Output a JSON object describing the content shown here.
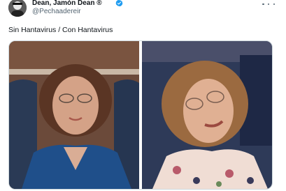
{
  "post": {
    "author_name": "Dean, Jamón Dean ®",
    "handle": "@Pechaadereir",
    "verified": true,
    "text": "Sin Hantavirus / Con Hantavirus"
  },
  "media": {
    "panels": [
      {
        "description_icon": "photo-left"
      },
      {
        "description_icon": "photo-right"
      }
    ]
  },
  "colors": {
    "verified_blue": "#1d9bf0",
    "text_primary": "#0f1419",
    "text_secondary": "#536471"
  }
}
